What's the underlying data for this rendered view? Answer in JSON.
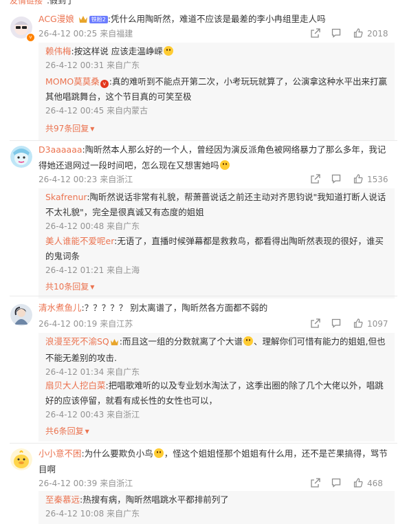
{
  "header_cut": {
    "name": "友情链接",
    "text": ":假到了"
  },
  "colors": {
    "username": "#eb7350",
    "meta": "#939393",
    "reply_bg": "#f7f7f7"
  },
  "comments": [
    {
      "user": "ACG漫娘",
      "fan_badge": "铁粉2",
      "text": ":凭什么用陶昕然，难道不应该是最差的李小冉组里走人吗",
      "date": "26-4-12 00:25",
      "location": "来自福建",
      "likes": "2018",
      "replies": [
        {
          "user": "赖伟梅",
          "text": ":按这样说 应该走温峥嵘",
          "date": "26-4-12 00:31",
          "location": "来自广东"
        },
        {
          "user": "MOMO莫莫桑",
          "text": ":真的难听到不能点开第二次，小考玩玩就算了，公演拿这种水平出来打赢其他唱跳舞台，这个节目真的可笑至极",
          "date": "26-4-12 00:45",
          "location": "来自内蒙古"
        }
      ],
      "more": "共97条回复"
    },
    {
      "user": "D3aaaaaa",
      "text": ":陶昕然本人那么好的一个人，曾经因为演反派角色被网络暴力了那么多年，我记得她还退网过一段时间吧，怎么现在又想害她吗",
      "date": "26-4-12 00:23",
      "location": "来自浙江",
      "likes": "1536",
      "replies": [
        {
          "user": "Skafrenur",
          "text": ":陶昕然说话非常有礼貌，帮萧蔷说话之前还主动对齐思钧说\"我知道打断人说话不太礼貌\"，完全是很真诚又有态度的姐姐",
          "date": "26-4-12 00:48",
          "location": "来自广东"
        },
        {
          "user": "美人谁能不爱呢er",
          "text": ":无语了，直播时候弹幕都是救救鸟，都看得出陶昕然表现的很好，谁买的鬼词条",
          "date": "26-4-12 01:21",
          "location": "来自上海"
        }
      ],
      "more": "共10条回复"
    },
    {
      "user": "清水煮鱼儿",
      "text": ":？？？？？ 别太离谱了，陶昕然各方面都不弱的",
      "date": "26-4-12 00:19",
      "location": "来自江苏",
      "likes": "1097",
      "replies": [
        {
          "user": "浪漫至死不渝SQ",
          "text": ":而且这一组的分数就离了个大谱",
          "text2": "、理解你们可惜有能力的姐姐,但也不能无差别的攻击.",
          "date": "26-4-12 01:34",
          "location": "来自广东"
        },
        {
          "user": "扇贝大人挖白菜",
          "text": ":把唱歌难听的以及专业划水淘汰了，这季出圈的除了几个大佬以外，唱跳好的应该停留，就看有成长性的女性也可以，",
          "date": "26-4-12 00:43",
          "location": "来自浙江"
        }
      ],
      "more": "共6条回复"
    },
    {
      "user": "小小意不困",
      "text": ":为什么要欺负小鸟",
      "text2": "，怪这个姐姐怪那个姐姐有什么用，还不是芒果搞得，骂节目啊",
      "date": "26-4-12 00:39",
      "location": "来自浙江",
      "likes": "468",
      "replies": [
        {
          "user": "至秦慕远",
          "text": ":热搜有病，陶昕然唱跳水平都排前列了",
          "date": "26-4-12 10:08",
          "location": "来自广东"
        }
      ]
    }
  ]
}
